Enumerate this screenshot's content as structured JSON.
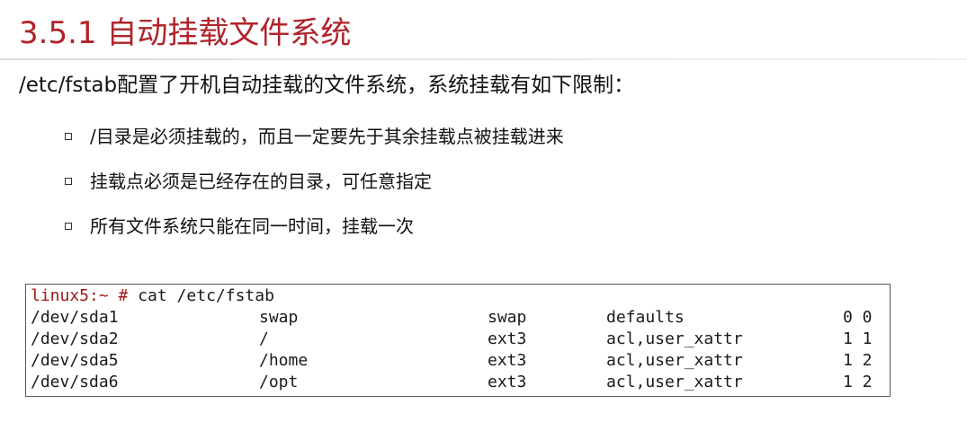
{
  "slide": {
    "title": "3.5.1 自动挂载文件系统",
    "intro": "/etc/fstab配置了开机自动挂载的文件系统，系统挂载有如下限制：",
    "bullets": [
      "/目录是必须挂载的，而且一定要先于其余挂载点被挂载进来",
      "挂载点必须是已经存在的目录，可任意指定",
      "所有文件系统只能在同一时间，挂载一次"
    ],
    "title_color": "#b0232a"
  },
  "terminal": {
    "prompt": "linux5:~ #",
    "command": " cat /etc/fstab",
    "prompt_color": "#a01818",
    "rows": [
      {
        "device": "/dev/sda1",
        "mount": "swap",
        "type": "swap",
        "options": "defaults",
        "dump_pass": "0 0"
      },
      {
        "device": "/dev/sda2",
        "mount": "/",
        "type": "ext3",
        "options": "acl,user_xattr",
        "dump_pass": "1 1"
      },
      {
        "device": "/dev/sda5",
        "mount": "/home",
        "type": "ext3",
        "options": "acl,user_xattr",
        "dump_pass": "1 2"
      },
      {
        "device": "/dev/sda6",
        "mount": "/opt",
        "type": "ext3",
        "options": "acl,user_xattr",
        "dump_pass": "1 2"
      }
    ]
  }
}
